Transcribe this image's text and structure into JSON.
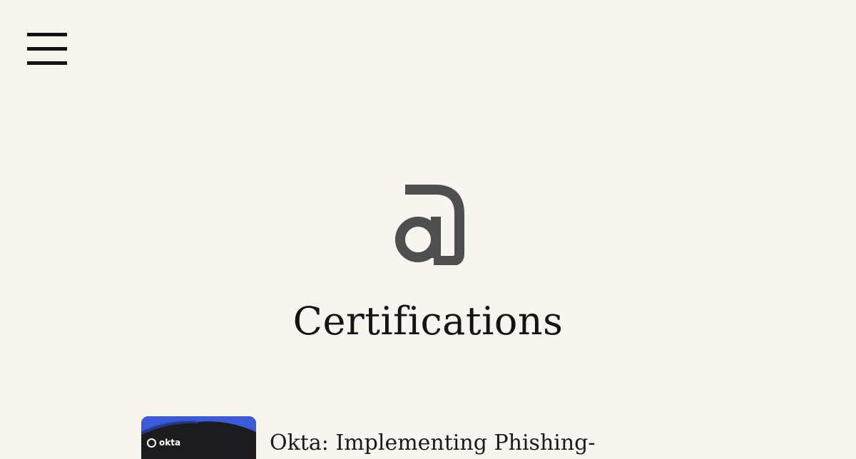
{
  "header": {
    "menu_icon": "hamburger-menu-icon"
  },
  "hero": {
    "logo_glyph": "@",
    "logo_icon": "at-sign-logo-icon",
    "title": "Certifications"
  },
  "certifications": [
    {
      "badge_brand": "okta",
      "badge_colors": {
        "top": "#3b5bdb",
        "body": "#1c1c1e"
      },
      "title": "Okta: Implementing Phishing-"
    }
  ]
}
